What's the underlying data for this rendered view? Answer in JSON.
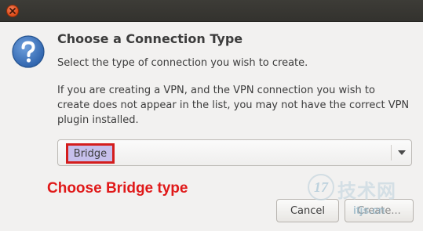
{
  "dialog": {
    "heading": "Choose a Connection Type",
    "subtext": "Select the type of connection you wish to create.",
    "info_lines": [
      "If you are creating a VPN, and the VPN connection you wish to",
      "create does not appear in the list, you may not have the correct VPN",
      "plugin installed."
    ]
  },
  "connection_type": {
    "selected": "Bridge"
  },
  "annotation": "Choose Bridge type",
  "buttons": {
    "cancel_label": "Cancel",
    "create_label": "Create..."
  },
  "watermark": {
    "badge": "17",
    "text": "技术网",
    "url": "itjs.cn"
  },
  "icons": {
    "close": "close-icon",
    "dialog": "question-icon",
    "dropdown": "chevron-down-icon"
  },
  "colors": {
    "annotation": "#e01919",
    "highlight_border": "#d41d1d",
    "selection_fill": "#c6c0ec",
    "close_button": "#e0501e",
    "dialog_icon": "#3f78c2"
  }
}
